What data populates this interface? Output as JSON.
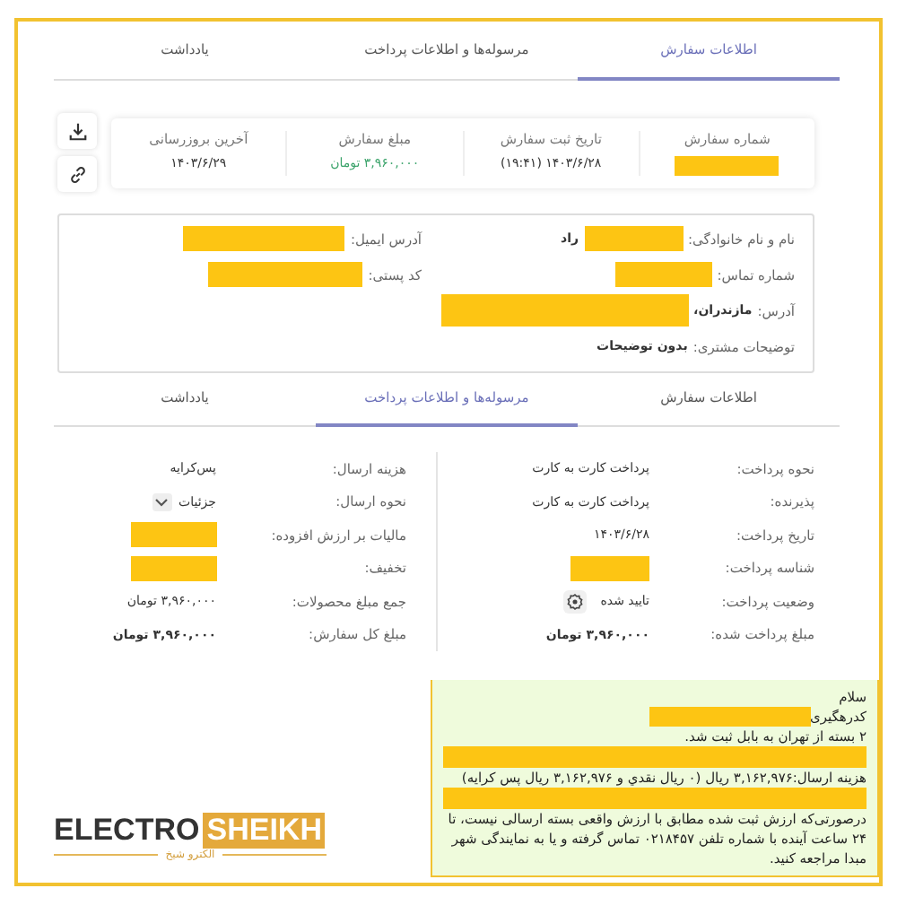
{
  "top_tabs": [
    {
      "label": "اطلاعات سفارش",
      "selected": true
    },
    {
      "label": "مرسوله‌ها و اطلاعات پرداخت",
      "selected": false
    },
    {
      "label": "یادداشت",
      "selected": false
    }
  ],
  "summary": [
    {
      "label": "شماره سفارش",
      "parts": [
        {
          "kind": "redacted"
        }
      ]
    },
    {
      "label": "تاریخ ثبت سفارش",
      "parts": [
        {
          "kind": "text",
          "text": "۱۴۰۳/۶/۲۸ (۱۹:۴۱)"
        }
      ]
    },
    {
      "label": "مبلغ سفارش",
      "parts": [
        {
          "kind": "amount",
          "text": "۳,۹۶۰,۰۰۰ تومان"
        }
      ]
    },
    {
      "label": "آخرین بروزرسانی",
      "parts": [
        {
          "kind": "text",
          "text": "۱۴۰۳/۶/۲۹"
        }
      ]
    }
  ],
  "customer_rows": [
    [
      {
        "label": "نام و نام خانوادگی:",
        "parts": [
          {
            "kind": "redacted"
          },
          {
            "kind": "text",
            "text": "راد"
          }
        ]
      },
      {
        "label": "آدرس ایمیل:",
        "parts": [
          {
            "kind": "redacted"
          }
        ]
      }
    ],
    [
      {
        "label": "شماره تماس:",
        "parts": [
          {
            "kind": "redacted"
          }
        ]
      },
      {
        "label": "کد پستی:",
        "parts": [
          {
            "kind": "redacted"
          }
        ]
      }
    ],
    [
      {
        "label": "آدرس:",
        "parts": [
          {
            "kind": "text",
            "text": "مازندران،"
          },
          {
            "kind": "redacted"
          }
        ]
      }
    ],
    [
      {
        "label": "توضیحات مشتری:",
        "parts": [
          {
            "kind": "text",
            "text": "بدون توضیحات"
          }
        ]
      }
    ]
  ],
  "shipment_tabs": [
    {
      "label": "اطلاعات سفارش",
      "selected": false
    },
    {
      "label": "مرسوله‌ها و اطلاعات پرداخت",
      "selected": true
    },
    {
      "label": "یادداشت",
      "selected": false
    }
  ],
  "payment": [
    {
      "label": "نحوه پرداخت:",
      "parts": [
        {
          "kind": "text",
          "text": "پرداخت کارت به کارت"
        }
      ]
    },
    {
      "label": "پذیرنده:",
      "parts": [
        {
          "kind": "text",
          "text": "پرداخت کارت به کارت"
        }
      ]
    },
    {
      "label": "تاریخ پرداخت:",
      "parts": [
        {
          "kind": "text",
          "text": "۱۴۰۳/۶/۲۸"
        }
      ]
    },
    {
      "label": "شناسه پرداخت:",
      "parts": [
        {
          "kind": "redacted"
        }
      ]
    },
    {
      "label": "وضعیت پرداخت:",
      "parts": [
        {
          "kind": "status",
          "text": "تایید شده"
        }
      ]
    },
    {
      "label": "مبلغ پرداخت شده:",
      "parts": [
        {
          "kind": "strong",
          "text": "۳,۹۶۰,۰۰۰ تومان"
        }
      ]
    }
  ],
  "shipping": [
    {
      "label": "هزینه ارسال:",
      "parts": [
        {
          "kind": "text",
          "text": "پس‌کرایه"
        }
      ]
    },
    {
      "label": "نحوه ارسال:",
      "parts": [
        {
          "kind": "dropdown",
          "text": "جزئیات"
        }
      ]
    },
    {
      "label": "مالیات بر ارزش افزوده:",
      "parts": [
        {
          "kind": "redacted"
        }
      ]
    },
    {
      "label": "تخفیف:",
      "parts": [
        {
          "kind": "redacted"
        }
      ]
    },
    {
      "label": "جمع مبلغ محصولات:",
      "parts": [
        {
          "kind": "text",
          "text": "۳,۹۶۰,۰۰۰ تومان"
        }
      ]
    },
    {
      "label": "مبلغ کل سفارش:",
      "parts": [
        {
          "kind": "strong",
          "text": "۳,۹۶۰,۰۰۰ تومان"
        }
      ]
    }
  ],
  "logo": {
    "latin_1": "ELECTRO",
    "latin_2": "SHEIKH",
    "persian": "الکترو شیخ"
  },
  "message": [
    {
      "parts": [
        {
          "kind": "text",
          "text": "سلام"
        }
      ]
    },
    {
      "parts": [
        {
          "kind": "text",
          "text": "کدرهگیری"
        },
        {
          "kind": "redacted"
        }
      ]
    },
    {
      "parts": [
        {
          "kind": "text",
          "text": "۲ بسته از تهران به بابل ثبت شد."
        }
      ]
    },
    {
      "parts": [
        {
          "kind": "redacted"
        }
      ]
    },
    {
      "parts": [
        {
          "kind": "text",
          "text": "هزینه ارسال:۳,۱۶۲,۹۷۶ ریال  (۰ ریال نقدي و ۳,۱۶۲,۹۷۶ ریال پس کرایه)"
        }
      ]
    },
    {
      "parts": [
        {
          "kind": "redacted"
        }
      ]
    },
    {
      "parts": [
        {
          "kind": "text",
          "text": "درصورتی‌که ارزش ثبت شده مطابق با ارزش واقعی بسته ارسالی نیست، تا ۲۴ ساعت آینده با شماره تلفن ۰۲۱۸۴۵۷ تماس گرفته و یا به نمایندگی شهر مبدا مراجعه کنید."
        }
      ]
    }
  ]
}
